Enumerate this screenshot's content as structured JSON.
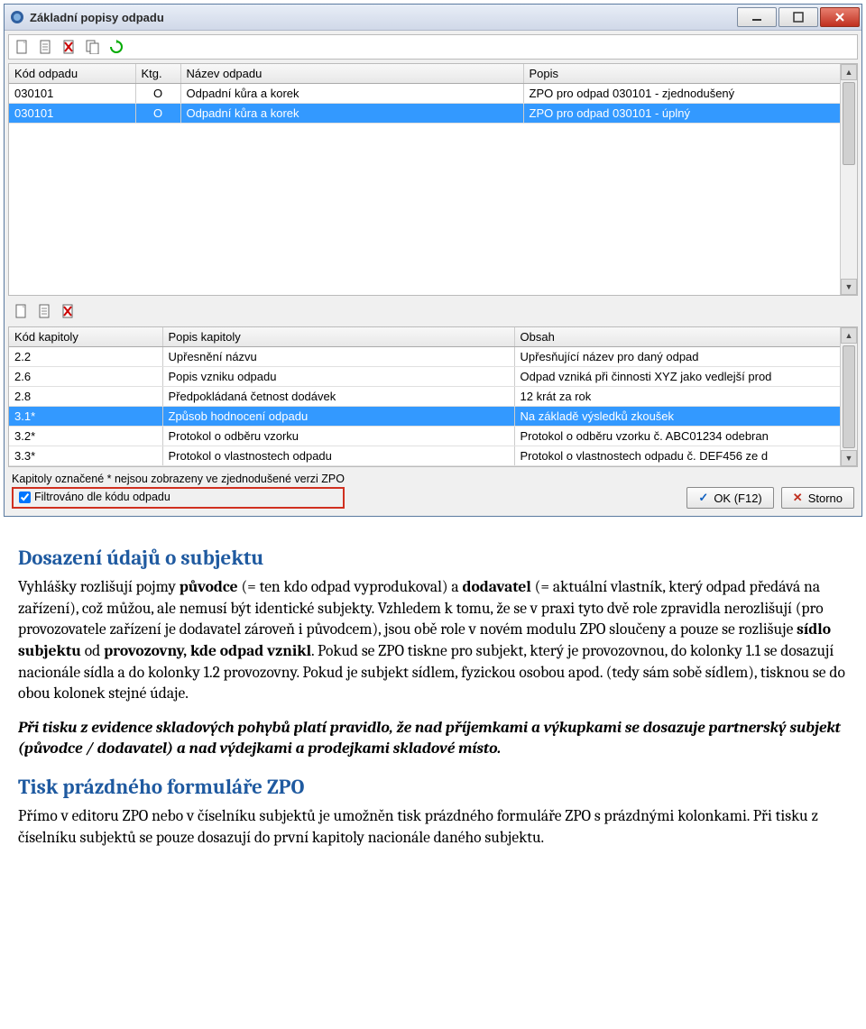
{
  "window": {
    "title": "Základní popisy odpadu"
  },
  "toolbar_top": {
    "icons": [
      "new-icon",
      "edit-icon",
      "delete-icon",
      "copy-icon",
      "refresh-icon"
    ]
  },
  "grid_top": {
    "headers": [
      "Kód odpadu",
      "Ktg.",
      "Název odpadu",
      "Popis"
    ],
    "rows": [
      {
        "kod": "030101",
        "ktg": "O",
        "nazev": "Odpadní kůra a korek",
        "popis": "ZPO pro odpad 030101 - zjednodušený",
        "selected": false
      },
      {
        "kod": "030101",
        "ktg": "O",
        "nazev": "Odpadní kůra a korek",
        "popis": "ZPO pro odpad 030101 - úplný",
        "selected": true
      }
    ]
  },
  "toolbar_mid": {
    "icons": [
      "new-icon",
      "edit-icon",
      "delete-icon"
    ]
  },
  "grid_bottom": {
    "headers": [
      "Kód kapitoly",
      "Popis kapitoly",
      "Obsah"
    ],
    "rows": [
      {
        "kod": "2.2",
        "popis": "Upřesnění názvu",
        "obsah": "Upřesňující název pro daný odpad",
        "selected": false
      },
      {
        "kod": "2.6",
        "popis": "Popis vzniku odpadu",
        "obsah": "Odpad vzniká při činnosti XYZ jako vedlejší prod",
        "selected": false
      },
      {
        "kod": "2.8",
        "popis": "Předpokládaná četnost dodávek",
        "obsah": "12 krát za rok",
        "selected": false
      },
      {
        "kod": "3.1*",
        "popis": "Způsob hodnocení odpadu",
        "obsah": "Na základě výsledků zkoušek",
        "selected": true
      },
      {
        "kod": "3.2*",
        "popis": "Protokol o odběru vzorku",
        "obsah": "Protokol o odběru vzorku č. ABC01234 odebran",
        "selected": false
      },
      {
        "kod": "3.3*",
        "popis": "Protokol o vlastnostech odpadu",
        "obsah": "Protokol o vlastnostech odpadu č. DEF456 ze d",
        "selected": false
      }
    ]
  },
  "footer": {
    "note": "Kapitoly označené * nejsou zobrazeny ve zjednodušené verzi ZPO",
    "filter_label": "Filtrováno dle kódu odpadu",
    "ok_label": "OK (F12)",
    "cancel_label": "Storno"
  },
  "doc": {
    "h1": "Dosazení údajů o subjektu",
    "p1a": "Vyhlášky rozlišují pojmy ",
    "p1b": "původce",
    "p1c": " (= ten kdo odpad vyprodukoval) a ",
    "p1d": "dodavatel",
    "p1e": " (= aktuální vlastník, který odpad předává na zařízení), což můžou, ale nemusí být identické subjekty. Vzhledem k tomu, že se v praxi tyto dvě role zpravidla nerozlišují (pro provozovatele zařízení je dodavatel zároveň i původcem), jsou obě role v novém modulu ZPO sloučeny a pouze se rozlišuje ",
    "p1f": "sídlo subjektu",
    "p1g": " od ",
    "p1h": "provozovny, kde odpad vznikl",
    "p1i": ". Pokud se ZPO tiskne pro subjekt, který je provozovnou, do kolonky 1.1 se dosazují nacionále sídla a do kolonky 1.2 provozovny. Pokud je subjekt sídlem, fyzickou osobou apod. (tedy sám sobě sídlem), tisknou se do obou kolonek stejné údaje.",
    "p2": "Při tisku z evidence skladových pohybů platí pravidlo, že nad příjemkami a výkupkami se dosazuje partnerský subjekt (původce / dodavatel) a nad výdejkami a prodejkami skladové místo.",
    "h2": "Tisk prázdného formuláře ZPO",
    "p3": "Přímo v editoru ZPO nebo v číselníku subjektů je umožněn tisk prázdného formuláře ZPO s prázdnými kolonkami. Při tisku z číselníku subjektů se pouze dosazují do první kapitoly nacionále daného subjektu."
  }
}
